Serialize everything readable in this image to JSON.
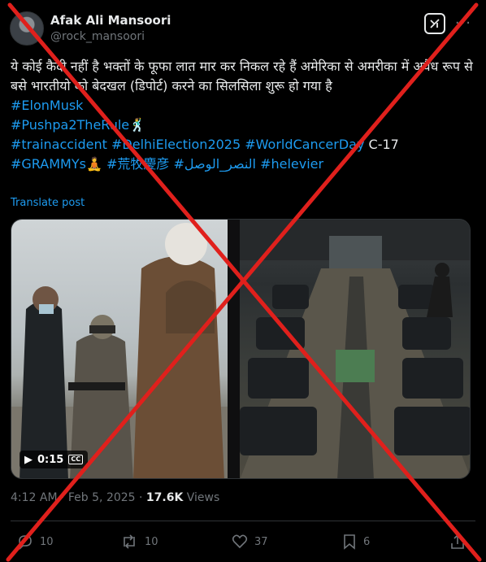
{
  "author": {
    "name": "Afak Ali Mansoori",
    "handle": "@rock_mansoori"
  },
  "tweet": {
    "text_line": "ये कोई कैदी नहीं है भक्तों के फूफा लात मार कर निकल रहे हैं अमेरिका से अमरीका में अवैध रूप से बसे भारतीयो को बेदखल (डिपोर्ट) करने का सिलसिला शुरू हो गया है",
    "hashtags_line1": "#ElonMusk",
    "hashtags_line2": "#Pushpa2TheRule",
    "hashtags_line3a": "#trainaccident #DelhiElection2025 #WorldCancerDay",
    "hashtags_line3b": " C-17",
    "hashtags_line4": "#GRAMMYs",
    "hashtags_line4b": " #荒牧慶彦 #النصر_الوصل #helevier",
    "translate": "Translate post"
  },
  "media": {
    "video_duration": "0:15",
    "icons": [
      "play-icon",
      "captions-icon"
    ]
  },
  "meta": {
    "time": "4:12 AM · Feb 5, 2025 · ",
    "views_count": "17.6K",
    "views_label": " Views"
  },
  "actions": {
    "replies": "10",
    "reposts": "10",
    "likes": "37",
    "bookmarks": "6"
  },
  "colors": {
    "background": "#000000",
    "text": "#e7e9ea",
    "muted": "#71767b",
    "link": "#1d9bf0",
    "overlay_cross": "#e0201c"
  }
}
